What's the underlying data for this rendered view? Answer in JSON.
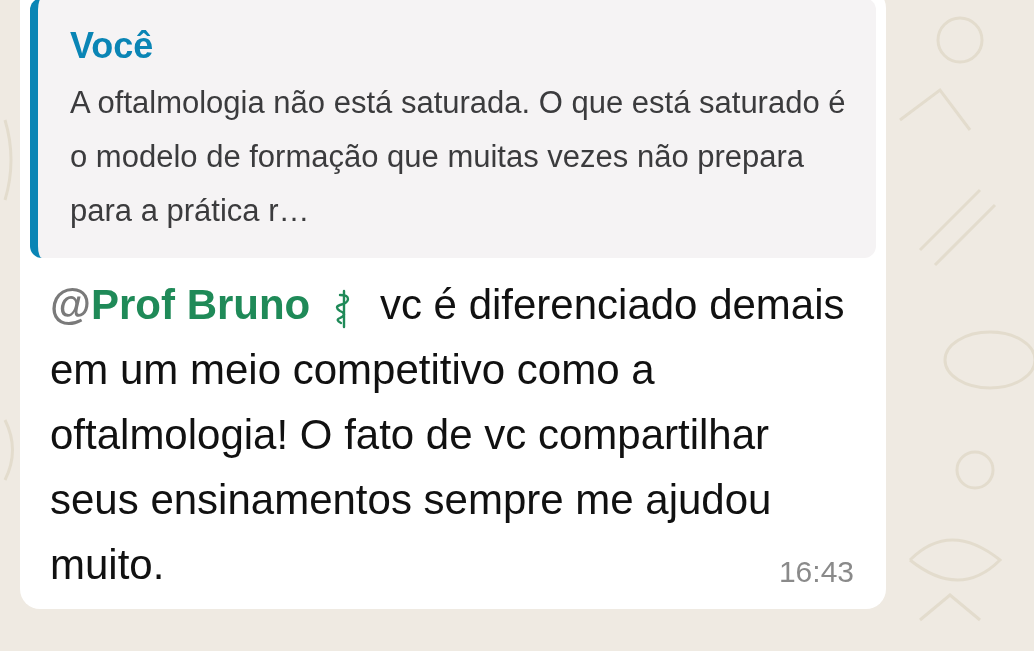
{
  "quoted_message": {
    "sender": "Você",
    "text": "A oftalmologia não está saturada. O que está saturado é o modelo de formação que muitas vezes não prepara para a prática r…"
  },
  "message": {
    "mention_prefix": "@",
    "mention_name": "Prof Bruno",
    "text": "vc é diferenciado demais em um meio competitivo como a oftalmologia! O fato de vc compartilhar seus ensinamentos sempre me ajudou muito.",
    "time": "16:43"
  }
}
